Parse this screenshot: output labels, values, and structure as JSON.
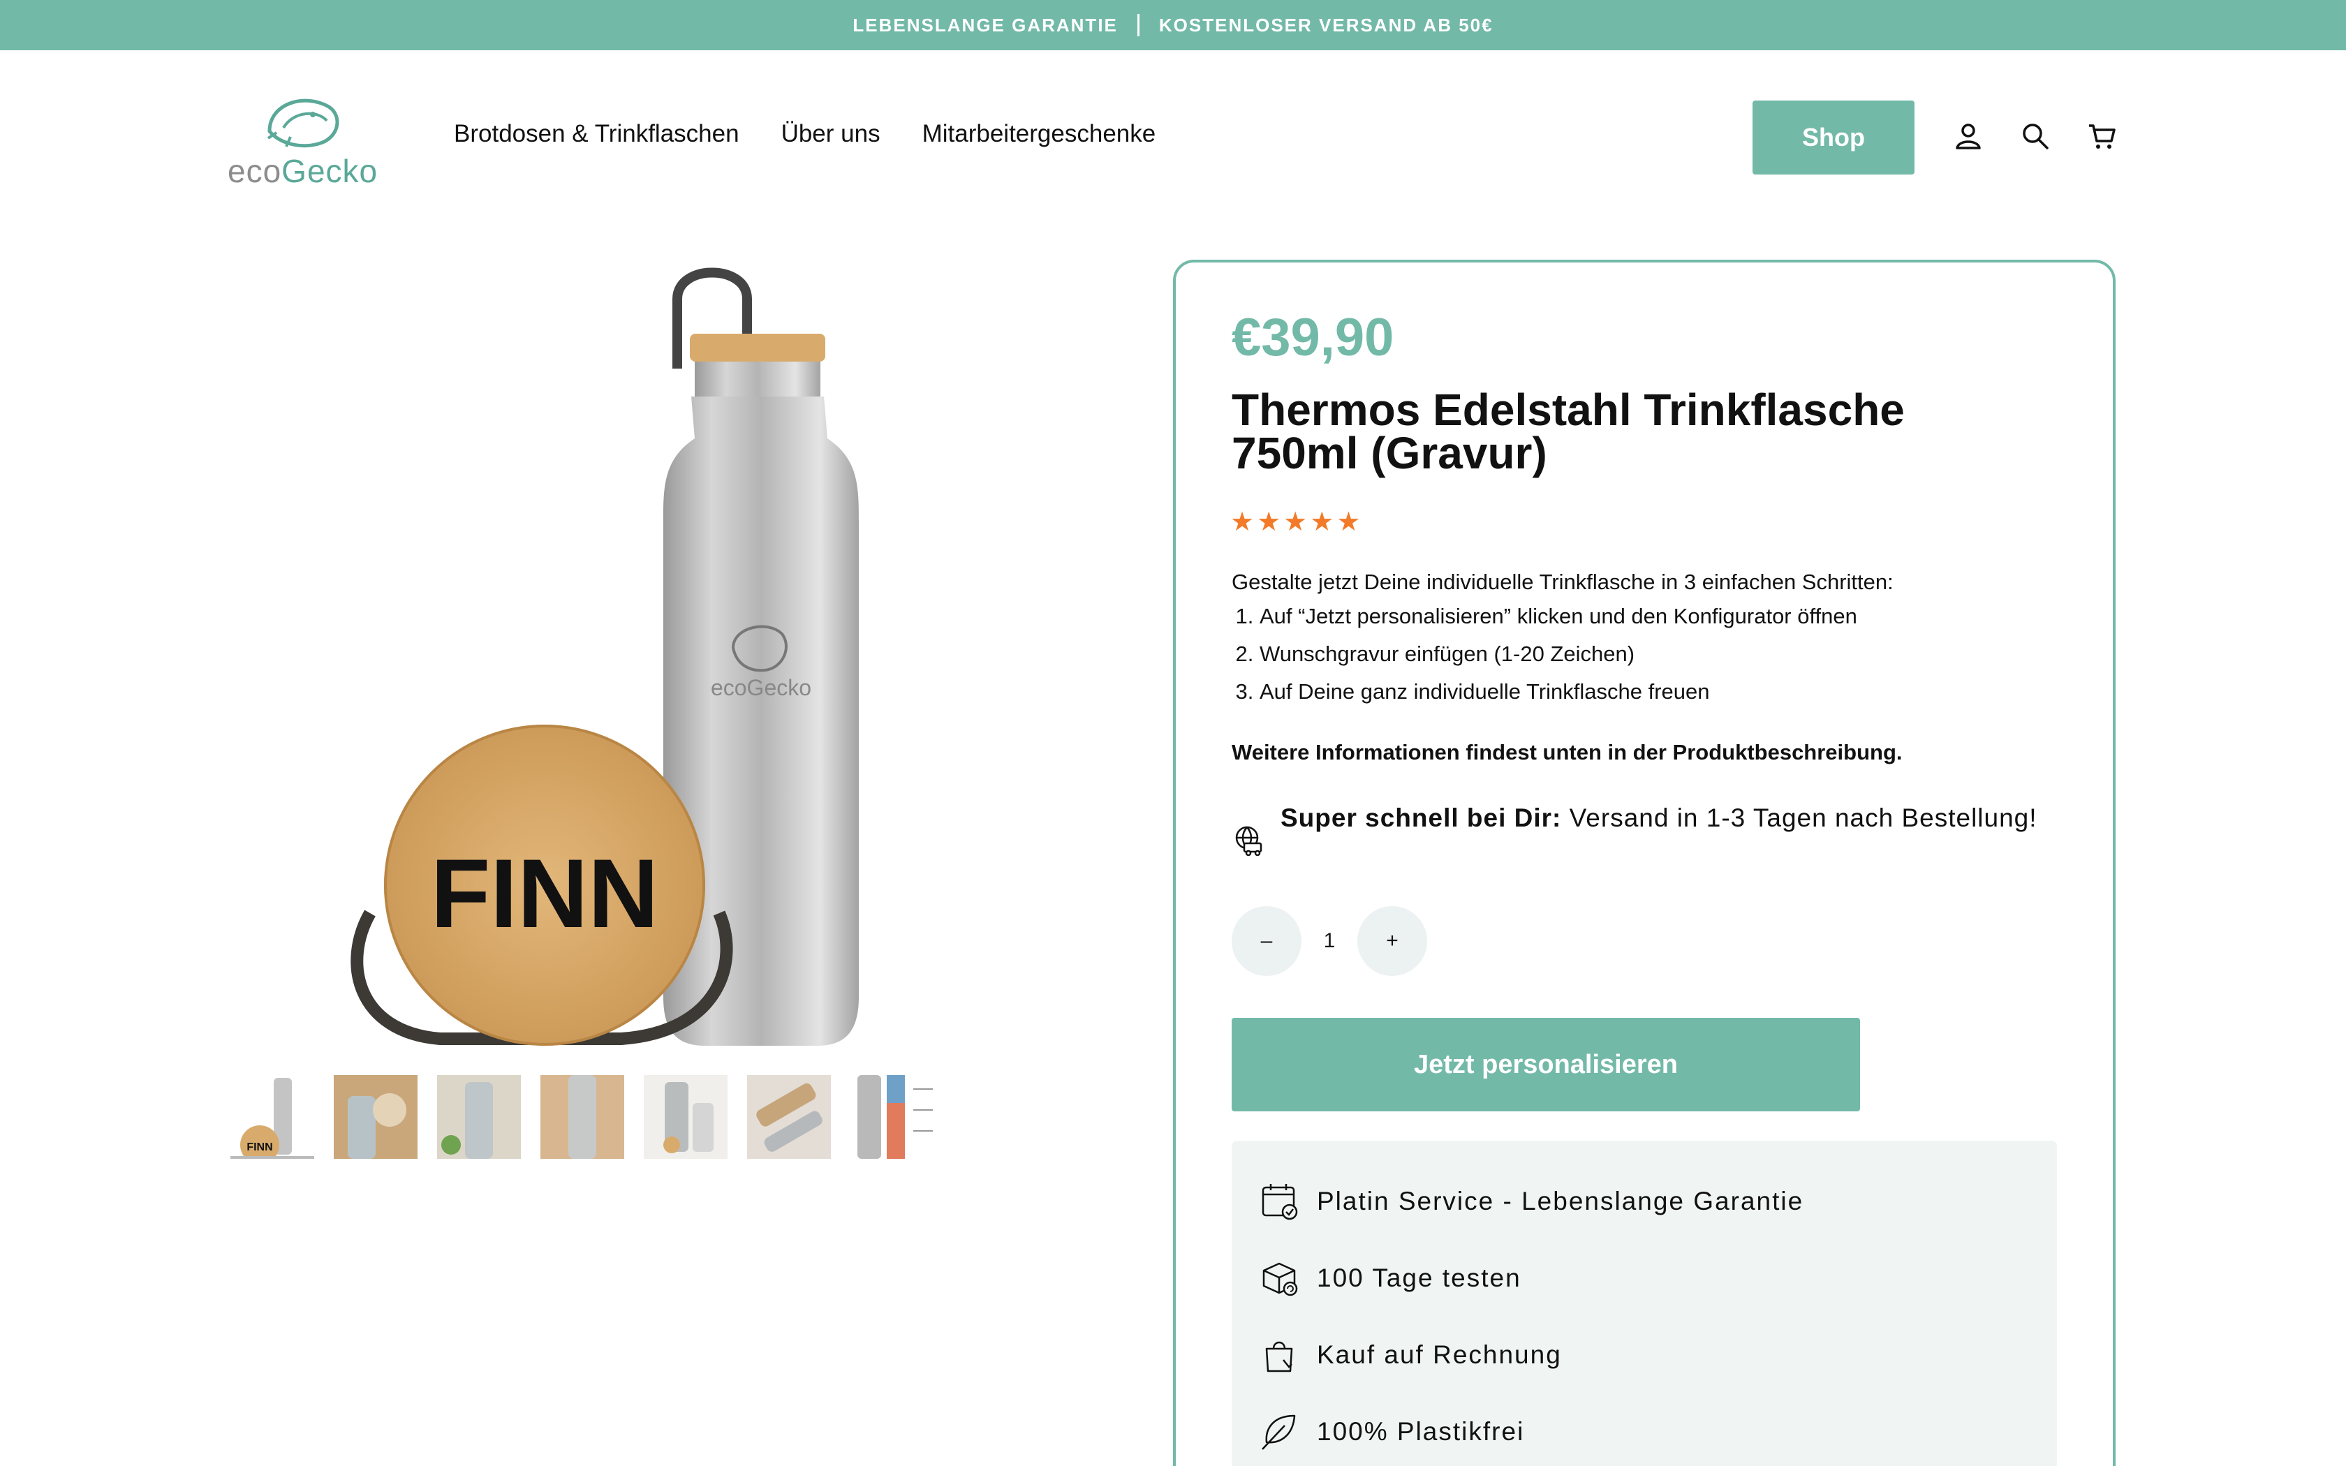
{
  "announcement": {
    "left": "LEBENSLANGE GARANTIE",
    "right": "KOSTENLOSER VERSAND AB 50€"
  },
  "brand": {
    "eco": "eco",
    "gecko": "Gecko"
  },
  "nav": {
    "items": [
      "Brotdosen & Trinkflaschen",
      "Über uns",
      "Mitarbeitergeschenke"
    ]
  },
  "header": {
    "shop_label": "Shop",
    "icons": [
      "account-icon",
      "search-icon",
      "cart-icon"
    ]
  },
  "gallery": {
    "main_engraving": "FINN",
    "thumb_count": 7,
    "thumb_engraving": "FINN"
  },
  "product": {
    "price": "€39,90",
    "title_line1": "Thermos Edelstahl Trinkflasche",
    "title_line2": "750ml (Gravur)",
    "rating_stars": 5,
    "intro": "Gestalte jetzt Deine individuelle Trinkflasche in 3 einfachen Schritten:",
    "steps": [
      "Auf “Jetzt personalisieren” klicken und den Konfigurator öffnen",
      "Wunschgravur einfügen (1-20 Zeichen)",
      "Auf Deine ganz individuelle Trinkflasche freuen"
    ],
    "more_info": "Weitere Informationen findest unten in der Produktbeschreibung.",
    "shipping_bold": "Super schnell bei Dir:",
    "shipping_rest": " Versand in 1-3 Tagen nach Bestellung!",
    "qty_minus": "–",
    "qty_value": "1",
    "qty_plus": "+",
    "cta_label": "Jetzt personalisieren"
  },
  "features": [
    "Platin Service - Lebenslange Garantie",
    "100 Tage testen",
    "Kauf auf Rechnung",
    "100% Plastikfrei"
  ],
  "colors": {
    "accent": "#73b9a8",
    "stars": "#f27a28",
    "feature_bg": "#f0f5f4"
  }
}
